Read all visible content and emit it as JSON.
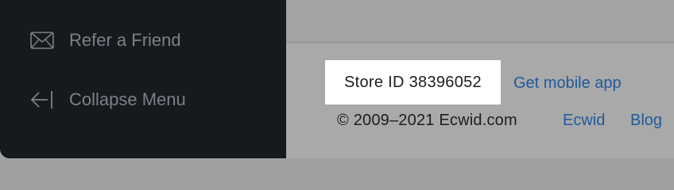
{
  "sidebar": {
    "items": [
      {
        "label": "Refer a Friend",
        "icon": "envelope-icon"
      },
      {
        "label": "Collapse Menu",
        "icon": "collapse-arrow-icon"
      }
    ]
  },
  "footer": {
    "store_id": "Store ID 38396052",
    "mobile_link": "Get mobile app",
    "copyright": "© 2009–2021 Ecwid.com",
    "ecwid_link": "Ecwid",
    "blog_link": "Blog"
  },
  "colors": {
    "sidebar_bg": "#16191d",
    "sidebar_text": "#7c8187",
    "link": "#1f5a9a",
    "overlay": "#a3a3a3"
  }
}
